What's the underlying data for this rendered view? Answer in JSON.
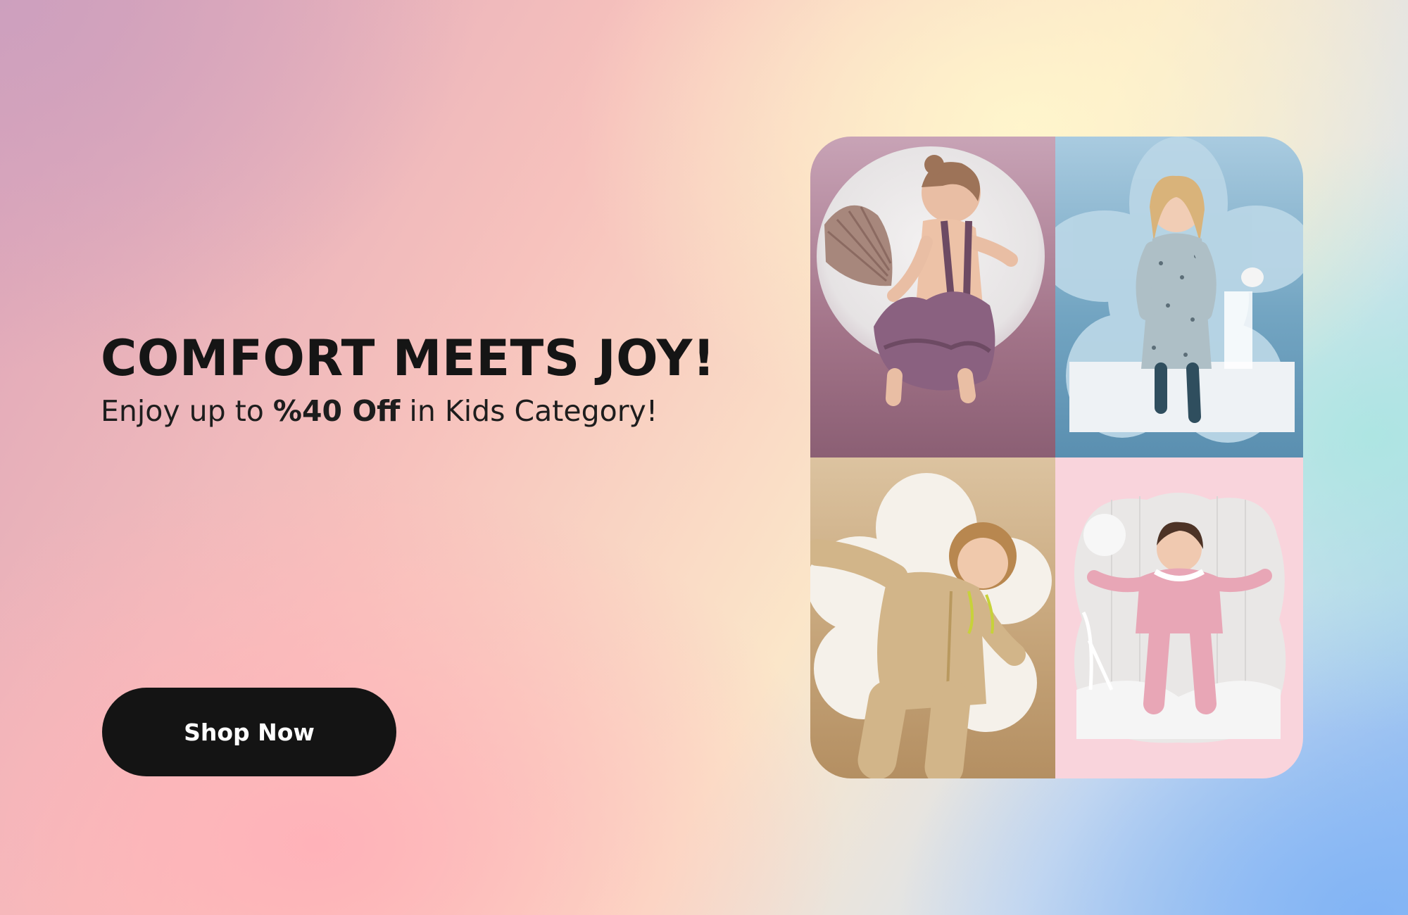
{
  "banner": {
    "headline": "COMFORT MEETS JOY!",
    "subline_prefix": "Enjoy up to ",
    "subline_highlight": "%40 Off",
    "subline_suffix": " in Kids Category!",
    "cta_label": "Shop Now"
  },
  "colors": {
    "text": "#151515",
    "button_bg": "#141414",
    "button_text": "#ffffff",
    "tile_mauve": "#a37489",
    "tile_blue": "#73a5c2",
    "tile_tan": "#c6a57a",
    "tile_pink": "#f9d4dc"
  },
  "collage": {
    "photos": [
      {
        "subject": "toddler in purple ruffled romper",
        "mask": "circle"
      },
      {
        "subject": "girl in grey patterned dress on bed",
        "mask": "flower"
      },
      {
        "subject": "curly-haired boy in beige hoodie",
        "mask": "flower"
      },
      {
        "subject": "girl in pink pajamas on bed",
        "mask": "cloud"
      }
    ]
  }
}
